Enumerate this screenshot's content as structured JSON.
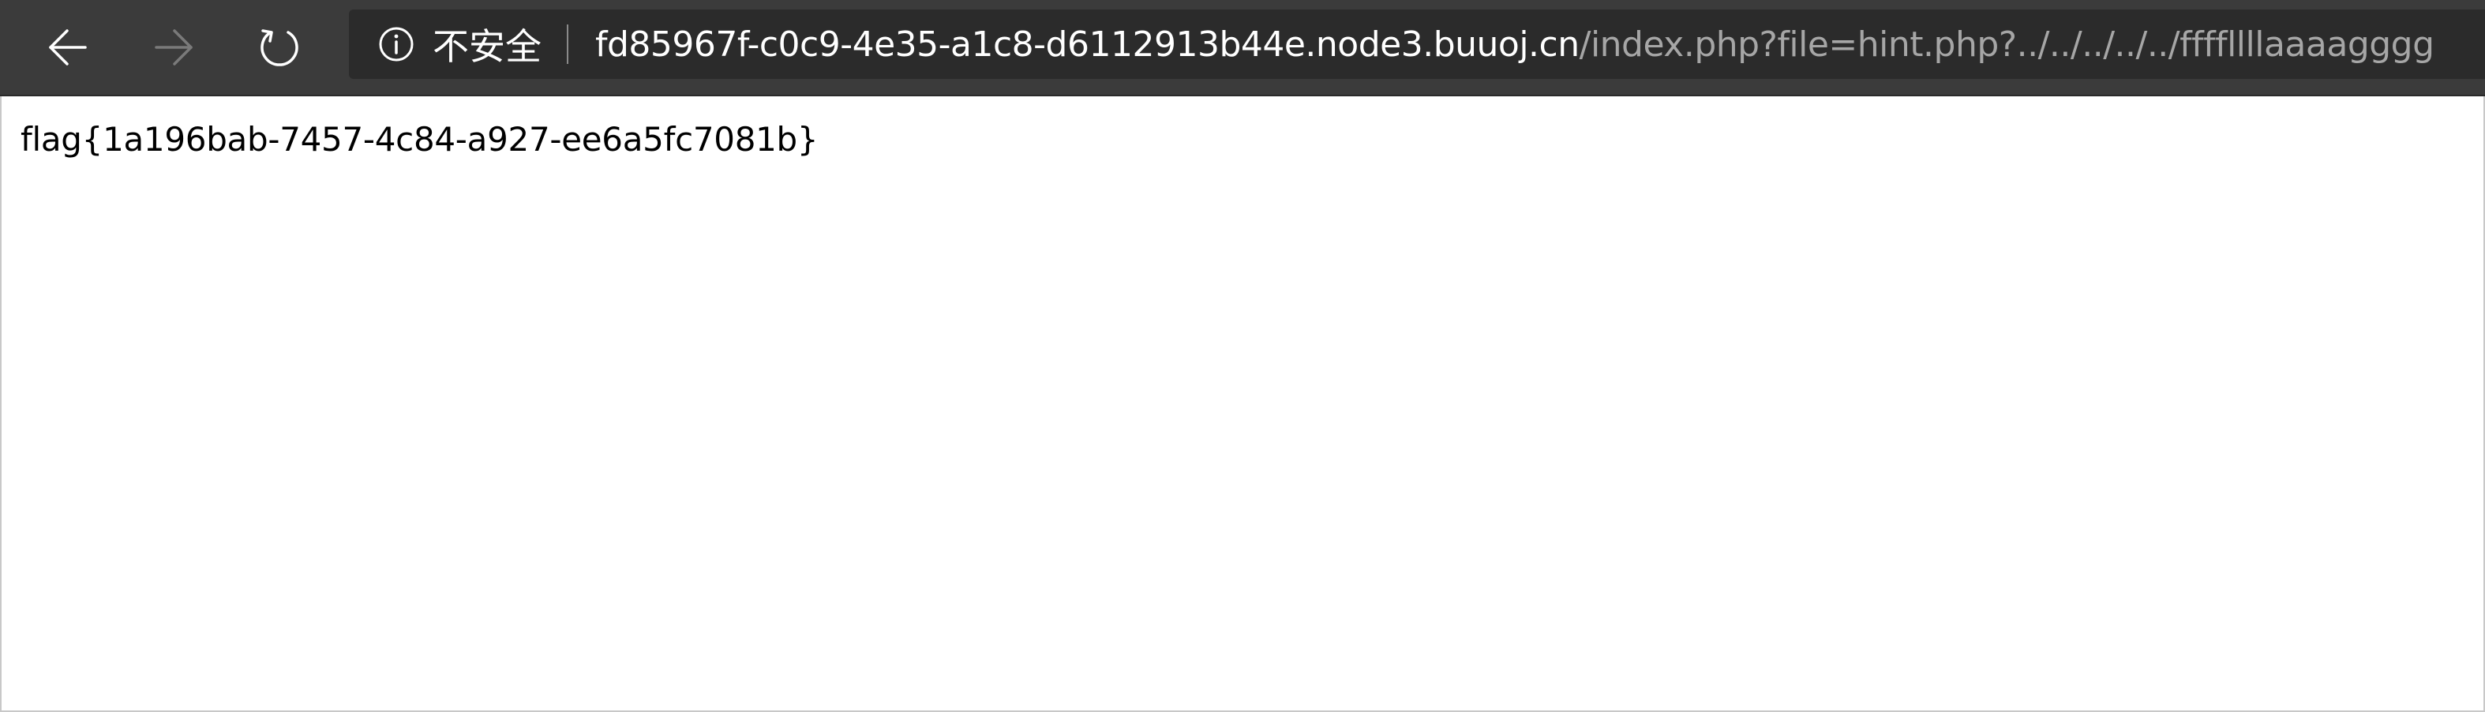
{
  "browser": {
    "nav": {
      "back_enabled": true,
      "forward_enabled": false,
      "icons": {
        "back": "arrow-left-icon",
        "forward": "arrow-right-icon",
        "reload": "reload-icon"
      }
    },
    "address_bar": {
      "security_icon": "info-icon",
      "security_label": "不安全",
      "url_host": "fd85967f-c0c9-4e35-a1c8-d6112913b44e.node3.buuoj.cn",
      "url_path": "/index.php?file=hint.php?../../../../../ffffllllaaaagggg"
    },
    "colors": {
      "toolbar_bg": "#3b3b3b",
      "addressbar_bg": "#2b2b2b",
      "host_text": "#ffffff",
      "path_text": "#a6a6a6",
      "disabled_icon": "#7a7a7a"
    }
  },
  "page": {
    "body_text": "flag{1a196bab-7457-4c84-a927-ee6a5fc7081b}"
  }
}
